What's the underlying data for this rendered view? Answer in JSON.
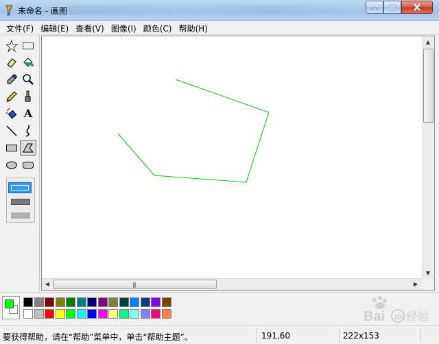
{
  "window": {
    "title": "未命名 - 画图"
  },
  "menu": [
    {
      "id": "file",
      "label": "文件(F)"
    },
    {
      "id": "edit",
      "label": "编辑(E)"
    },
    {
      "id": "view",
      "label": "查看(V)"
    },
    {
      "id": "image",
      "label": "图像(I)"
    },
    {
      "id": "colors",
      "label": "颜色(C)"
    },
    {
      "id": "help",
      "label": "帮助(H)"
    }
  ],
  "tools": [
    {
      "id": "free-form-select",
      "icon": "star-select-icon"
    },
    {
      "id": "select",
      "icon": "rect-select-icon"
    },
    {
      "id": "eraser",
      "icon": "eraser-icon"
    },
    {
      "id": "fill",
      "icon": "paint-bucket-icon"
    },
    {
      "id": "pick-color",
      "icon": "eyedropper-icon"
    },
    {
      "id": "magnifier",
      "icon": "magnifier-icon"
    },
    {
      "id": "pencil",
      "icon": "pencil-icon"
    },
    {
      "id": "brush",
      "icon": "brush-icon"
    },
    {
      "id": "airbrush",
      "icon": "airbrush-icon"
    },
    {
      "id": "text",
      "icon": "text-icon",
      "glyph": "A"
    },
    {
      "id": "line",
      "icon": "line-icon"
    },
    {
      "id": "curve",
      "icon": "curve-icon"
    },
    {
      "id": "rectangle",
      "icon": "rectangle-icon"
    },
    {
      "id": "polygon",
      "icon": "polygon-icon",
      "selected": true
    },
    {
      "id": "ellipse",
      "icon": "ellipse-icon"
    },
    {
      "id": "rounded-rectangle",
      "icon": "rounded-rectangle-icon"
    }
  ],
  "colors": {
    "foreground": "#00ff00",
    "background": "#ffffff",
    "stroke": "#00cc00",
    "palette_top": [
      "#000000",
      "#808080",
      "#800000",
      "#808000",
      "#008000",
      "#008080",
      "#000080",
      "#800080",
      "#808040",
      "#004040",
      "#0080ff",
      "#004080",
      "#8000ff",
      "#804000"
    ],
    "palette_bottom": [
      "#ffffff",
      "#c0c0c0",
      "#ff0000",
      "#ffff00",
      "#00ff00",
      "#00ffff",
      "#0000ff",
      "#ff00ff",
      "#ffff80",
      "#00ff80",
      "#80ffff",
      "#8080ff",
      "#ff0080",
      "#ff8040"
    ]
  },
  "status": {
    "message": "要获得帮助，请在“帮助”菜单中，单击“帮助主题”。",
    "coordinates": "191,60",
    "canvas_size": "222x153"
  },
  "watermark": {
    "brand": "Bai",
    "suffix": "经验"
  }
}
